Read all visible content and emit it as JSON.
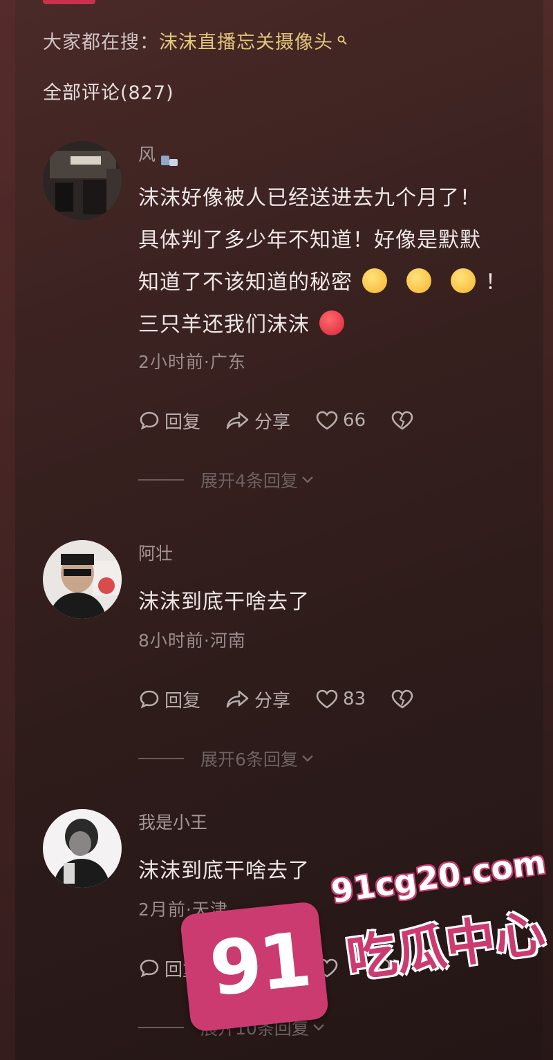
{
  "search": {
    "prefix": "大家都在搜：",
    "term": "沫沫直播忘关摄像头"
  },
  "comments_header": "全部评论(827)",
  "comments": [
    {
      "username": "风",
      "lines": [
        "沫沫好像被人已经送进去九个月了！",
        "具体判了多少年不知道！好像是默默",
        "知道了不该知道的秘密",
        "三只羊还我们沫沫"
      ],
      "line3_suffix": "！",
      "meta": "2小时前·广东",
      "reply_label": "回复",
      "share_label": "分享",
      "likes": "66",
      "expand": "展开4条回复"
    },
    {
      "username": "阿壮",
      "text": "沫沫到底干啥去了",
      "meta": "8小时前·河南",
      "reply_label": "回复",
      "share_label": "分享",
      "likes": "83",
      "expand": "展开6条回复"
    },
    {
      "username": "我是小王",
      "text": "沫沫到底干啥去了",
      "meta": "2月前·天津",
      "reply_label": "回复",
      "share_label": "分享",
      "likes": "",
      "expand": "展开10条回复"
    }
  ],
  "watermark": {
    "number": "91",
    "domain": "91cg20.com",
    "name": "吃瓜中心"
  },
  "colors": {
    "accent_search": "#e3c77a",
    "watermark_pink": "#cc3b6f"
  }
}
